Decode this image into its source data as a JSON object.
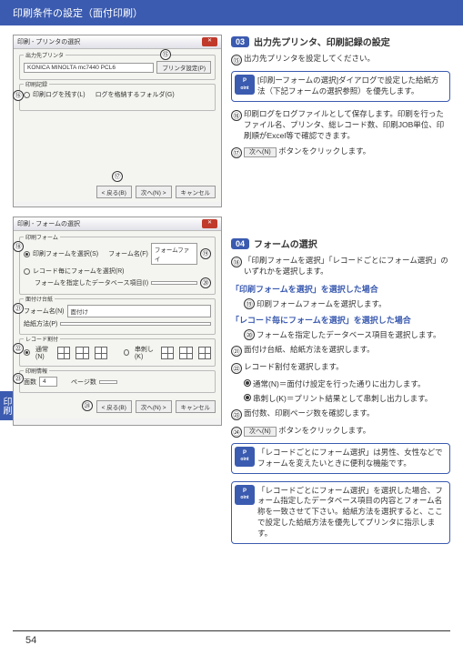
{
  "page_title": "印刷条件の設定（面付印刷）",
  "page_num": "54",
  "side_tab": "印刷",
  "shot1": {
    "title": "印刷 - プリンタの選択",
    "group1": "出力先プリンタ",
    "printer": "KONICA MINOLTA mc7440 PCL6",
    "btn_prop": "プリンタ設定(P)",
    "group2": "印刷記録",
    "chk": "印刷ログを残す(L)",
    "folder_label": "ログを格納するフォルダ(G)",
    "back": "< 戻る(B)",
    "next": "次へ(N) >",
    "cancel": "キャンセル"
  },
  "shot2": {
    "title": "印刷 - フォームの選択",
    "group1": "印刷フォーム",
    "r1": "印刷フォームを選択(S)",
    "r2": "レコード毎にフォームを選択(R)",
    "flabel": "フォーム名(F)",
    "fval": "フォームファイ",
    "dlabel": "フォームを指定したデータベース項目(I)",
    "group2": "面付け台紙",
    "t1": "フォーム名(N)",
    "t1v": "面付け",
    "t2": "給紙方法(P)",
    "group3": "レコード割付",
    "ra": "通常(N)",
    "rb": "串刺し(K)",
    "group4": "印刷情報",
    "info1": "面数",
    "info1v": "4",
    "info2": "ページ数",
    "back": "< 戻る(B)",
    "next": "次へ(N) >",
    "cancel": "キャンセル"
  },
  "sec03": {
    "badge": "03",
    "title": "出力先プリンタ、印刷記録の設定",
    "i15": "出力先プリンタを設定してください。",
    "point1": "[印刷ーフォームの選択]ダイアログで設定した給紙方法（下記フォームの選択参照）を優先します。",
    "i16": "印刷ログをログファイルとして保存します。印刷を行ったファイル名、プリンタ、総レコード数、印刷JOB単位、印刷順がExcel等で確認できます。",
    "i17a": "",
    "i17btn": "次へ(N)",
    "i17b": "ボタンをクリックします。"
  },
  "sec04": {
    "badge": "04",
    "title": "フォームの選択",
    "i18": "「印刷フォームを選択」「レコードごとにフォーム選択」のいずれかを選択します。",
    "sub1": "「印刷フォームを選択」を選択した場合",
    "i19": "印刷フォームフォームを選択します。",
    "sub2": "「レコード毎にフォームを選択」を選択した場合",
    "i20": "フォームを指定したデータベース項目を選択します。",
    "i21": "面付け台紙、給紙方法を選択します。",
    "i22": "レコード割付を選択します。",
    "r1a": "通常(N)",
    "r1b": "＝面付け設定を行った通りに出力します。",
    "r2a": "串刺し(K)",
    "r2b": "＝プリント結果として串刺し出力します。",
    "i23": "面付数、印刷ページ数を確認します。",
    "i24btn": "次へ(N)",
    "i24b": "ボタンをクリックします。",
    "point2": "「レコードごとにフォーム選択」は男性、女性などでフォームを変えたいときに便利な機能です。",
    "point3": "「レコードごとにフォーム選択」を選択した場合、フォーム指定したデータベース項目の内容とフォーム名称を一致させて下さい。給紙方法を選択すると、ここで設定した給紙方法を優先してプリンタに指示します。"
  },
  "pt": "P",
  "pt2": "oint"
}
